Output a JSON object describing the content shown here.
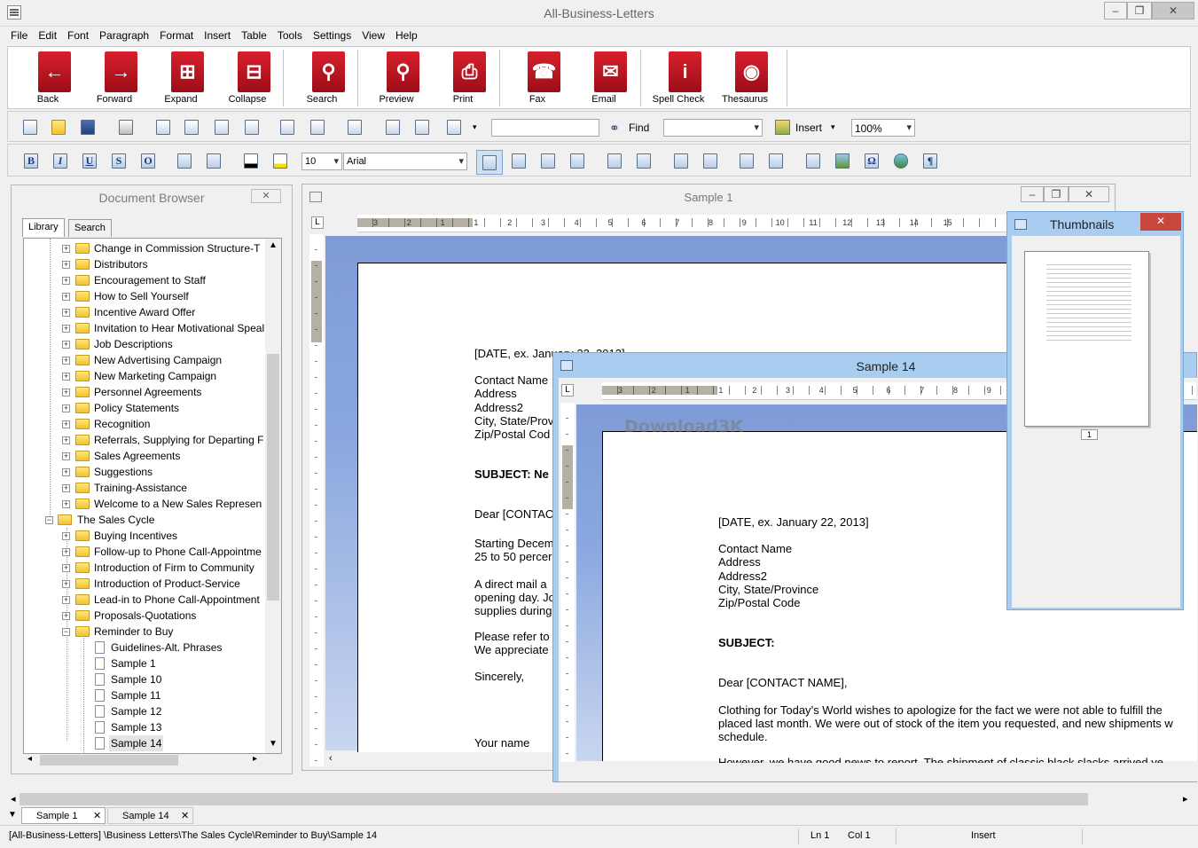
{
  "app": {
    "title": "All-Business-Letters"
  },
  "menu": [
    "File",
    "Edit",
    "Font",
    "Paragraph",
    "Format",
    "Insert",
    "Table",
    "Tools",
    "Settings",
    "View",
    "Help"
  ],
  "big_toolbar": [
    "Back",
    "Forward",
    "Expand",
    "Collapse",
    "Search",
    "Preview",
    "Print",
    "Fax",
    "Email",
    "Spell Check",
    "Thesaurus"
  ],
  "toolbar": {
    "find_label": "Find",
    "insert_label": "Insert",
    "zoom": "100%"
  },
  "format_bar": {
    "font_size": "10",
    "font_name": "Arial",
    "bold": "B",
    "italic": "I",
    "underline": "U",
    "strike": "S",
    "outline": "O",
    "omega": "Ω",
    "pilcrow": "¶"
  },
  "doc_browser": {
    "title": "Document Browser",
    "tabs": [
      "Library",
      "Search"
    ],
    "items": [
      "Change in Commission Structure-T",
      "Distributors",
      "Encouragement to Staff",
      "How to Sell Yourself",
      "Incentive Award Offer",
      "Invitation to Hear Motivational Speal",
      "Job Descriptions",
      "New Advertising Campaign",
      "New Marketing Campaign",
      "Personnel Agreements",
      "Policy Statements",
      "Recognition",
      "Referrals, Supplying for Departing F",
      "Sales Agreements",
      "Suggestions",
      "Training-Assistance",
      "Welcome to a New Sales Represen"
    ],
    "group": "The Sales Cycle",
    "group_items": [
      "Buying Incentives",
      "Follow-up to Phone Call-Appointme",
      "Introduction of Firm to Community",
      "Introduction of Product-Service",
      "Lead-in to Phone Call-Appointment",
      "Proposals-Quotations",
      "Reminder to Buy"
    ],
    "leaf_items": [
      "Guidelines-Alt. Phrases",
      "Sample 1",
      "Sample 10",
      "Sample 11",
      "Sample 12",
      "Sample 13",
      "Sample 14"
    ]
  },
  "sample1": {
    "title": "Sample 1",
    "lines": [
      "[DATE, ex. January 22, 2013]",
      "Contact Name",
      "Address",
      "Address2",
      "City, State/Prov",
      "Zip/Postal Cod",
      "SUBJECT: Ne",
      "Dear [CONTAC",
      "Starting Decem",
      "25 to 50 percer",
      "A direct mail a",
      "opening day. Jo",
      "supplies during",
      "Please refer to",
      "We appreciate",
      "Sincerely,",
      "Your name"
    ]
  },
  "sample14": {
    "title": "Sample 14",
    "lines": [
      "[DATE, ex. January 22, 2013]",
      "Contact Name",
      "Address",
      "Address2",
      "City, State/Province",
      "Zip/Postal Code",
      "SUBJECT:",
      "Dear [CONTACT NAME],",
      "Clothing for Today’s World wishes to apologize for the fact we were not able to fulfill the",
      "placed last month. We were out of stock of the item you requested, and new shipments w",
      "schedule.",
      "However, we have good news to report. The shipment of classic black slacks arrived ye"
    ]
  },
  "ruler_numbers": [
    "3",
    "2",
    "1",
    "1",
    "2",
    "3",
    "4",
    "5",
    "6",
    "7",
    "8",
    "9",
    "10",
    "11",
    "12",
    "13",
    "14",
    "15"
  ],
  "thumbnails": {
    "title": "Thumbnails",
    "page_number": "1"
  },
  "doc_tabs": [
    "Sample 1",
    "Sample 14"
  ],
  "status": {
    "path": "[All-Business-Letters] \\Business Letters\\The Sales Cycle\\Reminder to Buy\\Sample 14",
    "ln": "Ln 1",
    "col": "Col 1",
    "mode": "Insert"
  },
  "watermark": "Download3K"
}
